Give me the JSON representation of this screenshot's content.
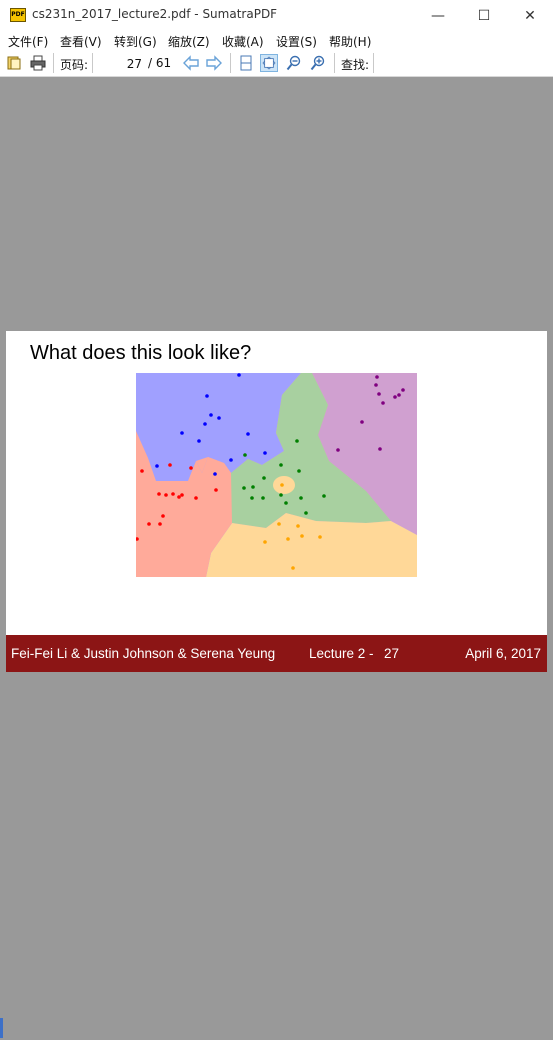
{
  "window": {
    "title": "cs231n_2017_lecture2.pdf - SumatraPDF",
    "icon_text": "PDF",
    "minimize_glyph": "—",
    "maximize_glyph": "☐",
    "close_glyph": "✕"
  },
  "menu": [
    "文件(F)",
    "查看(V)",
    "转到(G)",
    "缩放(Z)",
    "收藏(A)",
    "设置(S)",
    "帮助(H)"
  ],
  "toolbar": {
    "page_label": "页码:",
    "current_page": "27",
    "total_pages": "/ 61",
    "find_label": "查找:"
  },
  "slide": {
    "title": "What does this look like?",
    "footer_authors": "Fei-Fei Li & Justin Johnson & Serena Yeung",
    "footer_lecture": "Lecture 2 -",
    "footer_page": "27",
    "footer_date": "April 6, 2017"
  },
  "colors": {
    "canvas_bg": "#999999",
    "footer_bg": "#8c1515",
    "region_blue": "#a0a0ff",
    "region_purple": "#d0a0d0",
    "region_green": "#a8d0a0",
    "region_red": "#ffaa9a",
    "region_orange": "#ffd898"
  }
}
